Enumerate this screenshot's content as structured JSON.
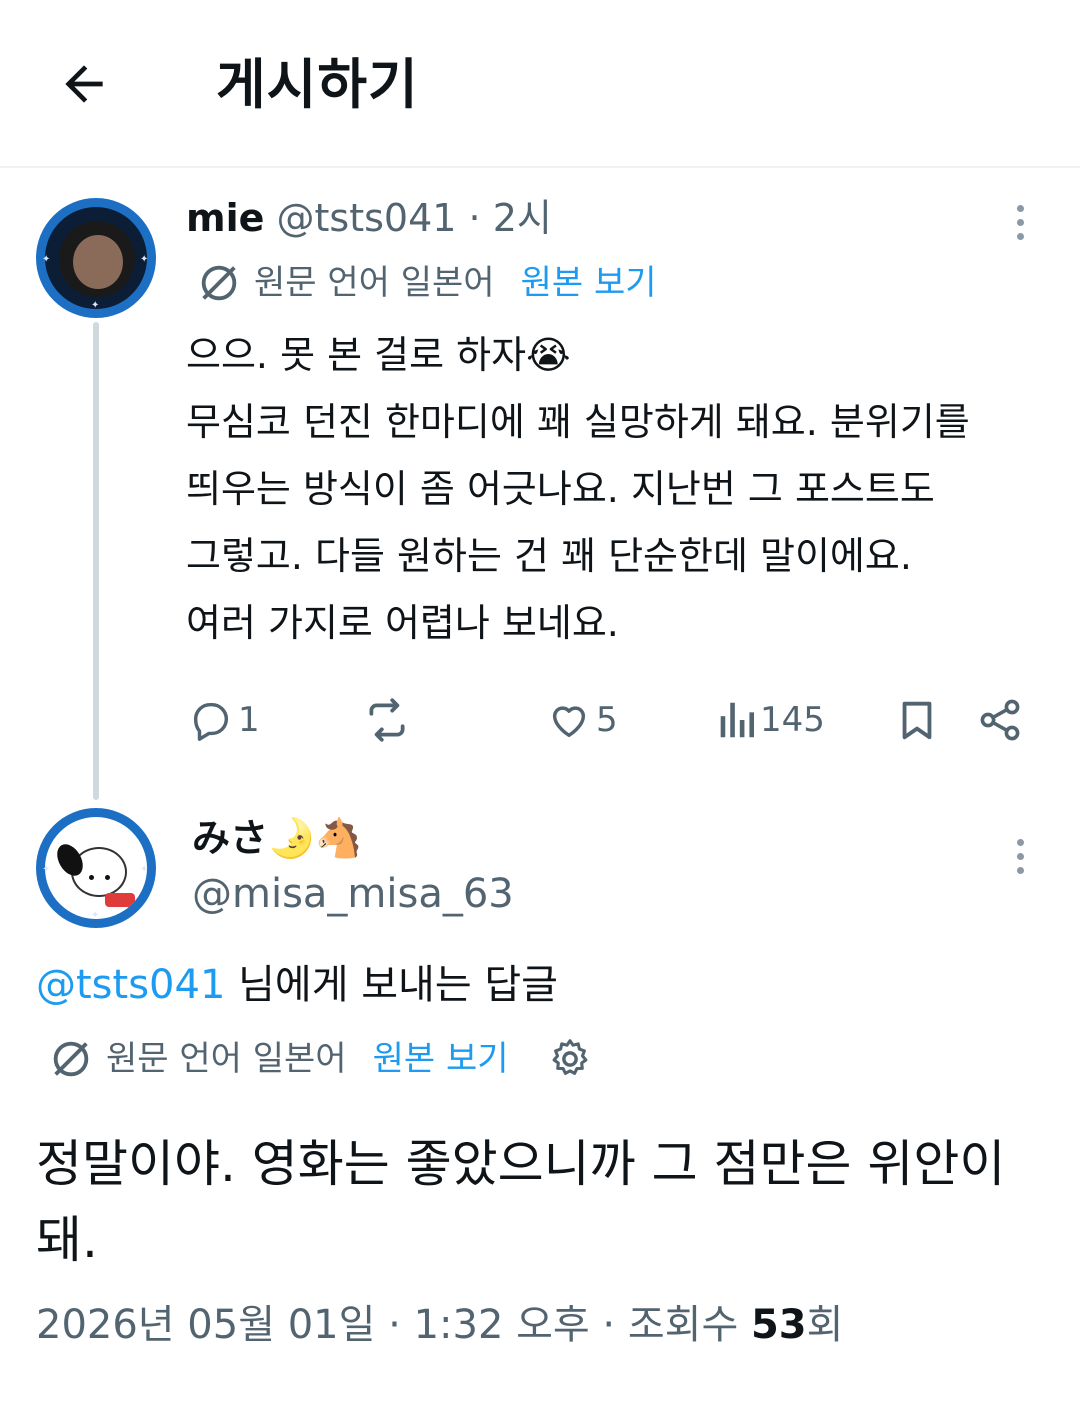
{
  "header": {
    "title": "게시하기"
  },
  "parent_post": {
    "display_name": "mie",
    "handle": "@tsts041",
    "time": "· 2시",
    "translation": {
      "label": "원문 언어 일본어",
      "link": "원본 보기"
    },
    "lines": [
      "으으. 못 본 걸로 하자😭",
      "무심코 던진 한마디에 꽤 실망하게 돼요. 분위기를",
      "띄우는 방식이 좀 어긋나요. 지난번 그 포스트도",
      "그렇고. 다들 원하는 건 꽤 단순한데 말이에요.",
      "여러 가지로 어렵나 보네요."
    ],
    "actions": {
      "replies": "1",
      "likes": "5",
      "views": "145"
    }
  },
  "reply_post": {
    "display_name": "みさ🌛🐴",
    "handle": "@misa_misa_63",
    "reply_to_mention": "@tsts041",
    "reply_to_suffix": " 님에게 보내는 답글",
    "translation": {
      "label": "원문 언어 일본어",
      "link": "원본 보기"
    },
    "lines": [
      "정말이야. 영화는 좋았으니까 그 점만은 위안이",
      "돼."
    ],
    "meta": {
      "date_time": "2026년 05월 01일 · 1:32 오후 · 조회수 ",
      "views": "53",
      "views_suffix": "회"
    }
  },
  "colors": {
    "accent": "#1d9bf0",
    "secondary_text": "#536471",
    "avatar_ring": "#1d6fc4"
  },
  "icons": [
    "back-arrow-icon",
    "more-icon",
    "translate-icon",
    "reply-icon",
    "repost-icon",
    "like-icon",
    "views-icon",
    "bookmark-icon",
    "share-icon",
    "settings-gear-icon"
  ]
}
